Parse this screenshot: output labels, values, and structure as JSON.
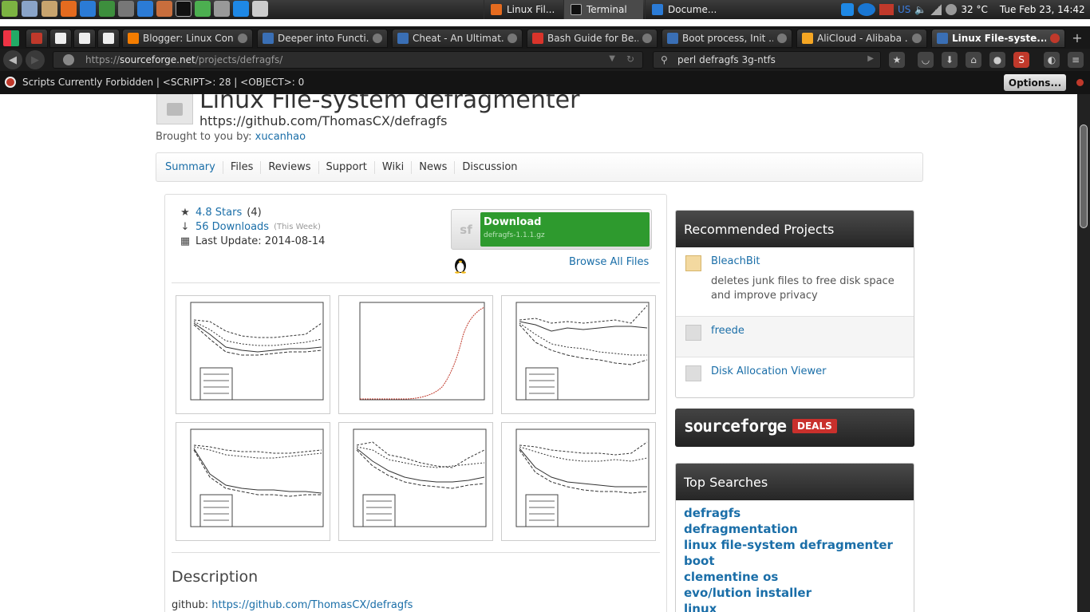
{
  "panel": {
    "taskbar": [
      {
        "label": "Linux Fil...",
        "active": false
      },
      {
        "label": "Terminal",
        "active": true
      },
      {
        "label": "Docume...",
        "active": false
      }
    ],
    "keyboard_layout": "US",
    "temperature": "32 °C",
    "datetime": "Tue Feb 23, 14:42"
  },
  "tabs": [
    {
      "label": "",
      "icon": "gmail-icon",
      "color": "#c0392b"
    },
    {
      "label": "",
      "icon": "page-icon",
      "color": "#eeeeee"
    },
    {
      "label": "",
      "icon": "page-icon",
      "color": "#eeeeee"
    },
    {
      "label": "",
      "icon": "page-icon",
      "color": "#eeeeee"
    },
    {
      "label": "Blogger: Linux Con...",
      "icon": "blogger-icon",
      "color": "#f57d00"
    },
    {
      "label": "Deeper into Functi...",
      "icon": "page-icon",
      "color": "#3a6fb5"
    },
    {
      "label": "Cheat - An Ultimat...",
      "icon": "page-icon",
      "color": "#3a6fb5"
    },
    {
      "label": "Bash Guide for Be...",
      "icon": "pdf-icon",
      "color": "#d9342b"
    },
    {
      "label": "Boot process, Init ...",
      "icon": "page-icon",
      "color": "#3a6fb5"
    },
    {
      "label": "AliCloud - Alibaba ...",
      "icon": "alicloud-icon",
      "color": "#f5a623"
    },
    {
      "label": "Linux File-syste...",
      "icon": "sourceforge-icon",
      "color": "#3a6fb5",
      "active": true
    }
  ],
  "nav": {
    "url_scheme": "https://",
    "url_host": "sourceforge.net",
    "url_path": "/projects/defragfs/",
    "search_value": "perl defragfs 3g-ntfs"
  },
  "noscript": {
    "message": "Scripts Currently Forbidden | <SCRIPT>: 28 | <OBJECT>: 0",
    "options_label": "Options..."
  },
  "project": {
    "title": "Linux File-system defragmenter",
    "url": "https://github.com/ThomasCX/defragfs",
    "brought_label": "Brought to you by:",
    "author": "xucanhao"
  },
  "project_tabs": [
    "Summary",
    "Files",
    "Reviews",
    "Support",
    "Wiki",
    "News",
    "Discussion"
  ],
  "stats": {
    "rating_link": "4.8 Stars",
    "rating_count": "(4)",
    "downloads_link": "56 Downloads",
    "downloads_period": "(This Week)",
    "last_update": "Last Update: 2014-08-14"
  },
  "download": {
    "sf_label": "sf",
    "label": "Download",
    "file": "defragfs-1.1.1.gz",
    "browse_label": "Browse All Files"
  },
  "description": {
    "heading": "Description",
    "prefix": "github: ",
    "link": "https://github.com/ThomasCX/defragfs"
  },
  "recommended": {
    "heading": "Recommended Projects",
    "items": [
      {
        "name": "BleachBit",
        "desc": "deletes junk files to free disk space and improve privacy"
      },
      {
        "name": "freede",
        "desc": ""
      },
      {
        "name": "Disk Allocation Viewer",
        "desc": ""
      }
    ]
  },
  "deals": {
    "logo": "sourceforge",
    "badge": "DEALS"
  },
  "top_searches": {
    "heading": "Top Searches",
    "items": [
      "defragfs",
      "defragmentation",
      "linux file-system defragmenter",
      "boot",
      "clementine os",
      "evo/lution installer",
      "linux"
    ]
  },
  "colors": {
    "link": "#1a6ea8",
    "download_green": "#2e9a2e",
    "deals_red": "#c9302c"
  }
}
